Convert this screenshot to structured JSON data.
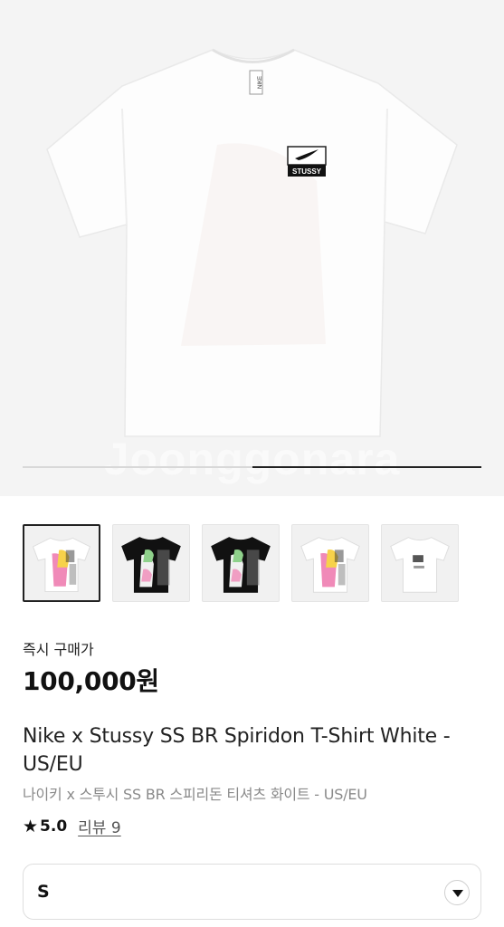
{
  "product_image": {
    "watermark": "Joonggonara",
    "shirt_label": "STUSSY",
    "tag_text": "NIKE",
    "gallery_progress": {
      "start": 0.5,
      "end": 1.0
    }
  },
  "thumbnails": [
    {
      "shirt_color": "#ffffff",
      "print": "pink-figure",
      "active": true
    },
    {
      "shirt_color": "#111111",
      "print": "figure",
      "active": false
    },
    {
      "shirt_color": "#111111",
      "print": "figure",
      "active": false
    },
    {
      "shirt_color": "#ffffff",
      "print": "pink-figure",
      "active": false
    },
    {
      "shirt_color": "#ffffff",
      "print": "small-logo",
      "active": false
    }
  ],
  "price": {
    "label": "즉시 구매가",
    "value": "100,000원"
  },
  "product": {
    "title": "Nike x Stussy SS BR Spiridon T-Shirt White - US/EU",
    "subtitle": "나이키 x 스투시 SS BR 스피리돈 티셔츠 화이트 - US/EU"
  },
  "rating": {
    "icon": "star-icon",
    "value": "5.0",
    "review_link": "리뷰 9"
  },
  "size_select": {
    "selected": "S",
    "icon": "chevron-down-icon"
  }
}
